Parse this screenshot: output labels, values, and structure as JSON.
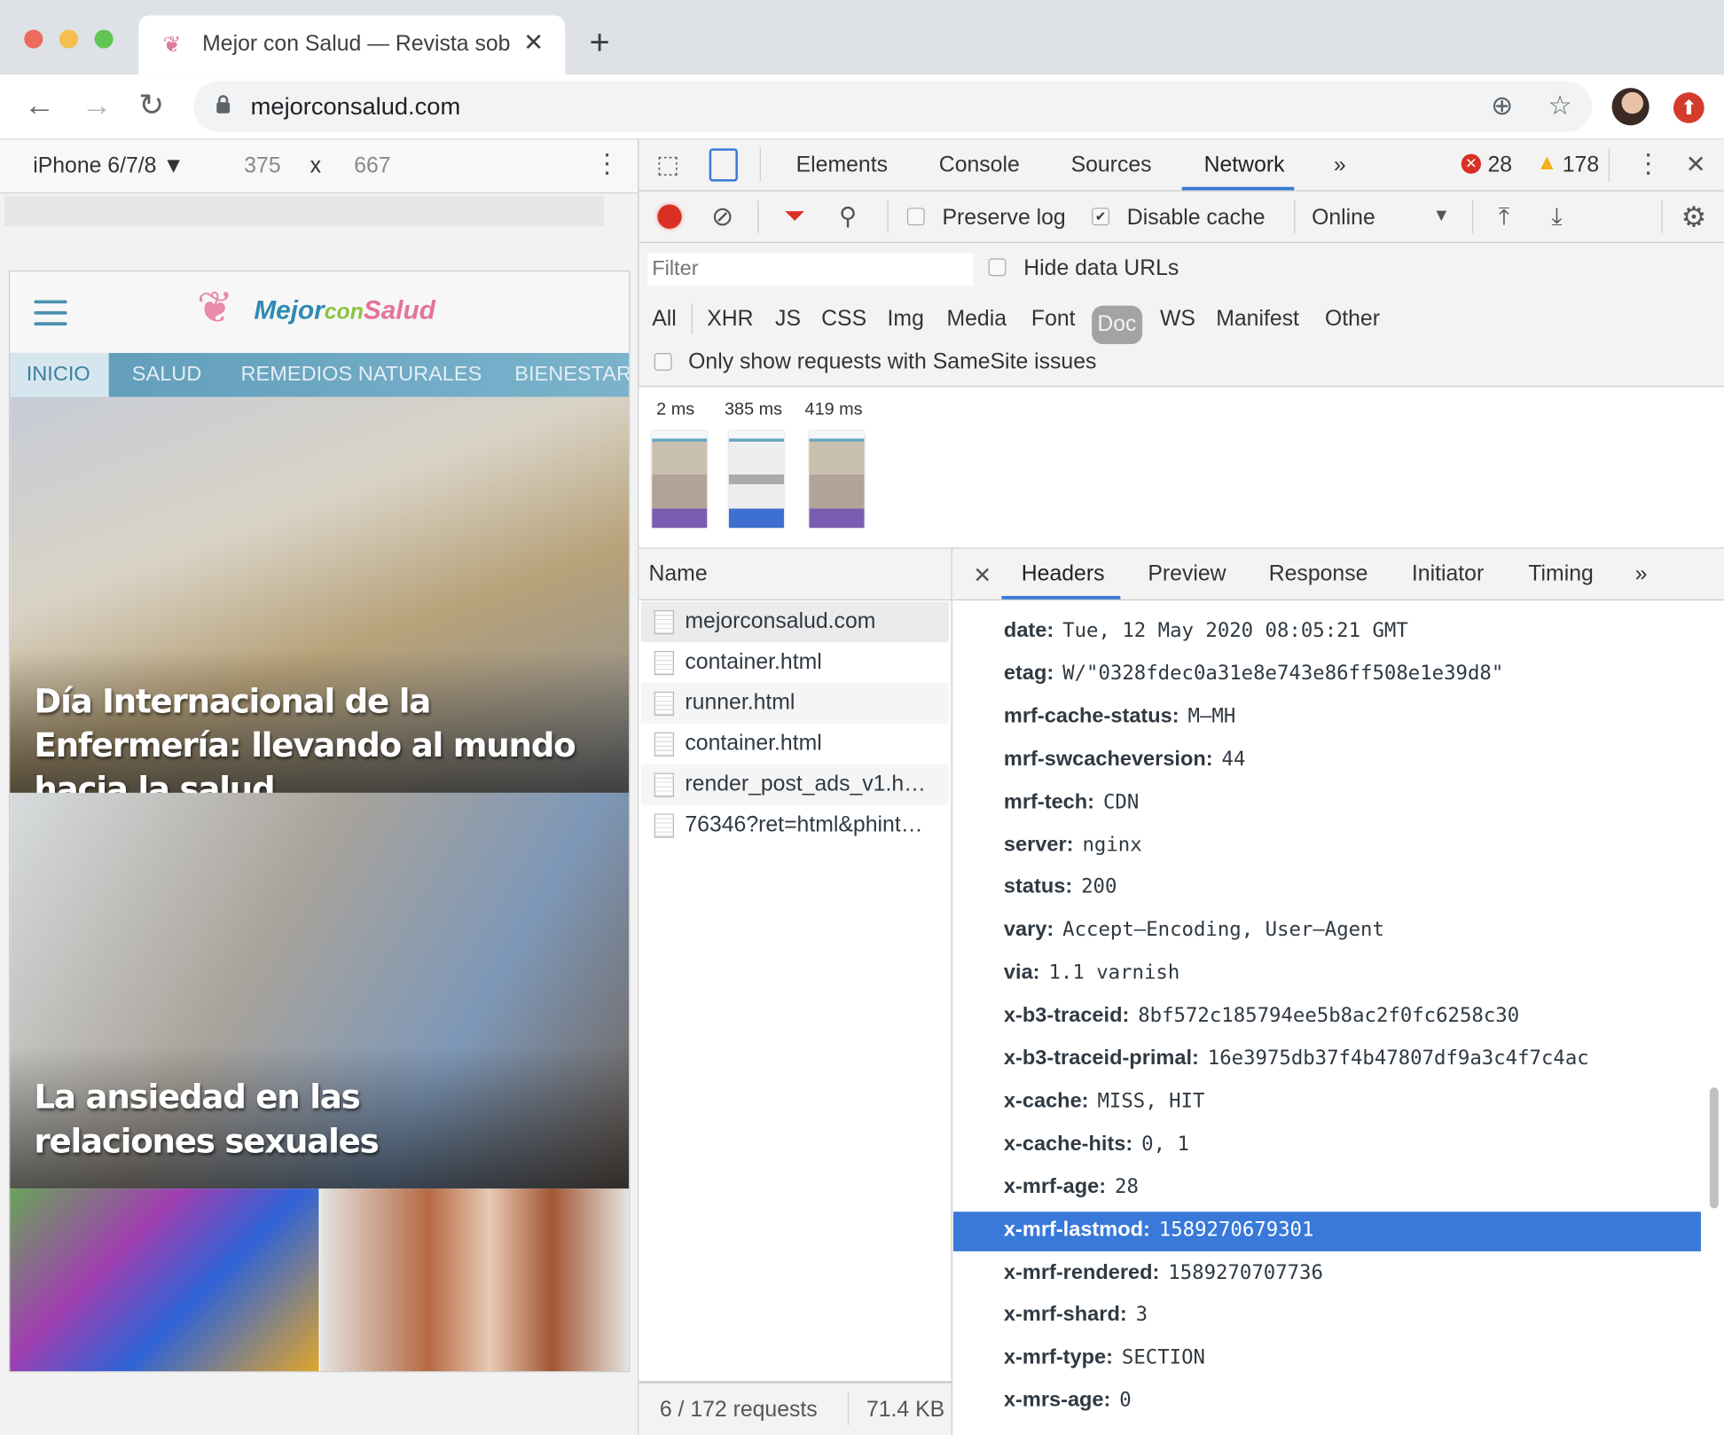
{
  "browser": {
    "tab_title": "Mejor con Salud — Revista sob",
    "url": "mejorconsalud.com",
    "icons": {
      "back": "arrow-left",
      "forward": "arrow-right",
      "reload": "reload",
      "lock": "lock",
      "install": "plus-circle",
      "bookmark": "star",
      "update": "arrow-up-circle"
    }
  },
  "device_toolbar": {
    "device": "iPhone 6/7/8 ▼",
    "width": "375",
    "times": "x",
    "height": "667"
  },
  "site": {
    "logo": {
      "part1": "Mejor",
      "part2": "con",
      "part3": "Salud"
    },
    "nav": [
      "INICIO",
      "SALUD",
      "REMEDIOS NATURALES",
      "BIENESTAR"
    ],
    "headlines": [
      "Día Internacional de la Enfermería: llevando al mundo hacia la salud",
      "La ansiedad en las relaciones sexuales"
    ]
  },
  "devtools": {
    "tabs": [
      "Elements",
      "Console",
      "Sources",
      "Network",
      "»"
    ],
    "active_tab": "Network",
    "errors": "28",
    "warnings": "178",
    "toolbar": {
      "preserve_log": "Preserve log",
      "preserve_log_checked": false,
      "disable_cache": "Disable cache",
      "disable_cache_checked": true,
      "throttle": "Online"
    },
    "filter": {
      "placeholder": "Filter",
      "hide_data_urls": "Hide data URLs",
      "types": [
        "All",
        "XHR",
        "JS",
        "CSS",
        "Img",
        "Media",
        "Font",
        "Doc",
        "WS",
        "Manifest",
        "Other"
      ],
      "active_type": "Doc",
      "samesite": "Only show requests with SameSite issues"
    },
    "filmstrip": [
      "2 ms",
      "385 ms",
      "419 ms"
    ],
    "requests": {
      "header": "Name",
      "rows": [
        "mejorconsalud.com",
        "container.html",
        "runner.html",
        "container.html",
        "render_post_ads_v1.h…",
        "76346?ret=html&phint…"
      ],
      "status": "6 / 172 requests",
      "size": "71.4 KB"
    },
    "detail": {
      "tabs": [
        "Headers",
        "Preview",
        "Response",
        "Initiator",
        "Timing",
        "»"
      ],
      "active_tab": "Headers",
      "headers": [
        {
          "k": "date:",
          "v": "Tue, 12 May 2020 08:05:21 GMT"
        },
        {
          "k": "etag:",
          "v": "W/\"0328fdec0a31e8e743e86ff508e1e39d8\""
        },
        {
          "k": "mrf-cache-status:",
          "v": "M–MH"
        },
        {
          "k": "mrf-swcacheversion:",
          "v": "44"
        },
        {
          "k": "mrf-tech:",
          "v": "CDN"
        },
        {
          "k": "server:",
          "v": "nginx"
        },
        {
          "k": "status:",
          "v": "200"
        },
        {
          "k": "vary:",
          "v": "Accept–Encoding, User–Agent"
        },
        {
          "k": "via:",
          "v": "1.1 varnish"
        },
        {
          "k": "x-b3-traceid:",
          "v": "8bf572c185794ee5b8ac2f0fc6258c30"
        },
        {
          "k": "x-b3-traceid-primal:",
          "v": "16e3975db37f4b47807df9a3c4f7c4ac"
        },
        {
          "k": "x-cache:",
          "v": "MISS, HIT"
        },
        {
          "k": "x-cache-hits:",
          "v": "0, 1"
        },
        {
          "k": "x-mrf-age:",
          "v": "28"
        },
        {
          "k": "x-mrf-lastmod:",
          "v": "1589270679301"
        },
        {
          "k": "x-mrf-rendered:",
          "v": "1589270707736"
        },
        {
          "k": "x-mrf-shard:",
          "v": "3"
        },
        {
          "k": "x-mrf-type:",
          "v": "SECTION"
        },
        {
          "k": "x-mrs-age:",
          "v": "0"
        }
      ],
      "selected_header": "x-mrf-lastmod:"
    }
  },
  "colors": {
    "accent": "#3879d9",
    "record": "#d93025",
    "filter": "#d93025",
    "error": "#d93025",
    "warning": "#f2b01e"
  }
}
